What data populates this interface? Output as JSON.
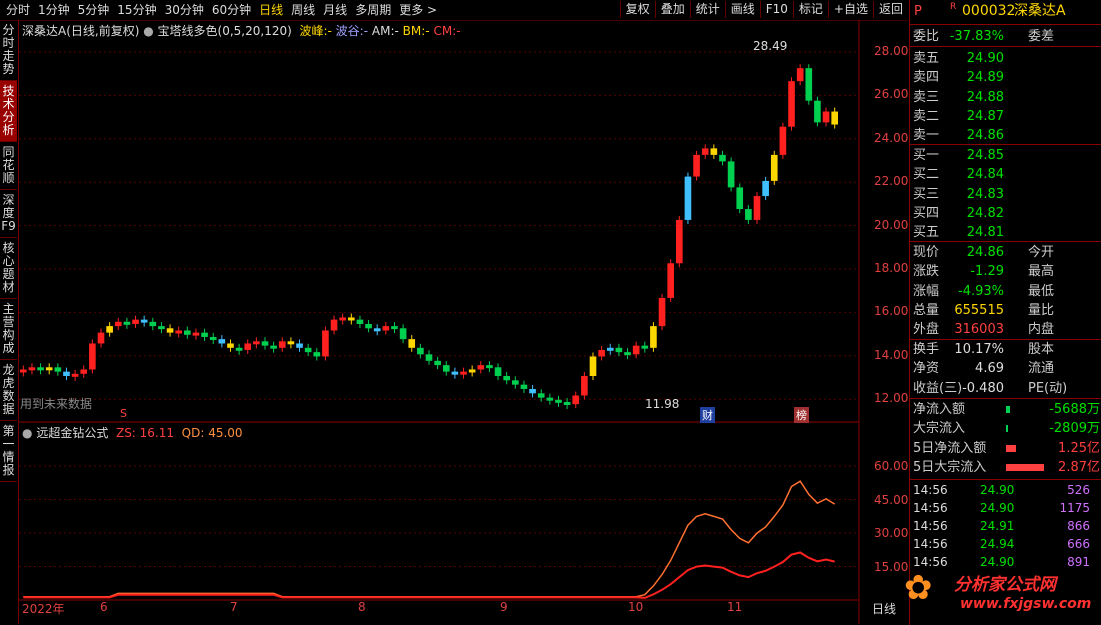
{
  "periods": [
    "分时",
    "1分钟",
    "5分钟",
    "15分钟",
    "30分钟",
    "60分钟",
    "日线",
    "周线",
    "月线",
    "多周期",
    "更多 >"
  ],
  "active_period": "日线",
  "toolbar": [
    "复权",
    "叠加",
    "统计",
    "画线",
    "F10",
    "标记",
    "+自选",
    "返回"
  ],
  "left_tabs": [
    "分时走势",
    "技术分析",
    "同花顺",
    "深度F9",
    "核心题材",
    "主营构成",
    "龙虎数据",
    "第一情报"
  ],
  "active_left_tab": "技术分析",
  "main_legend": {
    "title": "深桑达A(日线,前复权)",
    "indicator": "宝塔线多色(0,5,20,120)",
    "f1": "波峰:",
    "f1v": "-",
    "f2": "波谷:",
    "f2v": "-",
    "f3": "AM:",
    "f3v": "-",
    "f4": "BM:",
    "f4v": "-",
    "f5": "CM:",
    "f5v": "-"
  },
  "future_data": "用到未来数据",
  "high_label": "28.49",
  "low_label": "11.98",
  "event_cai": "财",
  "event_bang": "榜",
  "event_s": "S",
  "main_yticks": [
    "28.00",
    "26.00",
    "24.00",
    "22.00",
    "20.00",
    "18.00",
    "16.00",
    "14.00",
    "12.00"
  ],
  "sub_legend": {
    "name": "远超金钻公式",
    "zs": "ZS: 16.11",
    "qd": "QD: 45.00"
  },
  "sub_yticks": [
    "60.00",
    "45.00",
    "30.00",
    "15.00"
  ],
  "xaxis": [
    "2022年",
    "6",
    "7",
    "8",
    "9",
    "10",
    "11"
  ],
  "xaxis_right": "日线",
  "stock": {
    "flag": "P",
    "r": "R",
    "code": "000032",
    "name": "深桑达A"
  },
  "weibi": {
    "label": "委比",
    "value": "-37.83%",
    "label2": "委差"
  },
  "asks": [
    {
      "label": "卖五",
      "price": "24.90"
    },
    {
      "label": "卖四",
      "price": "24.89"
    },
    {
      "label": "卖三",
      "price": "24.88"
    },
    {
      "label": "卖二",
      "price": "24.87"
    },
    {
      "label": "卖一",
      "price": "24.86"
    }
  ],
  "bids": [
    {
      "label": "买一",
      "price": "24.85"
    },
    {
      "label": "买二",
      "price": "24.84"
    },
    {
      "label": "买三",
      "price": "24.83"
    },
    {
      "label": "买四",
      "price": "24.82"
    },
    {
      "label": "买五",
      "price": "24.81"
    }
  ],
  "quote": [
    {
      "l": "现价",
      "v": "24.86",
      "l2": "今开",
      "c": "g"
    },
    {
      "l": "涨跌",
      "v": "-1.29",
      "l2": "最高",
      "c": "g"
    },
    {
      "l": "涨幅",
      "v": "-4.93%",
      "l2": "最低",
      "c": "g"
    },
    {
      "l": "总量",
      "v": "655515",
      "l2": "量比",
      "c": "y"
    },
    {
      "l": "外盘",
      "v": "316003",
      "l2": "内盘",
      "c": "r"
    }
  ],
  "fund": [
    {
      "l": "换手",
      "v": "10.17%",
      "l2": "股本"
    },
    {
      "l": "净资",
      "v": "4.69",
      "l2": "流通"
    },
    {
      "l": "收益(三)",
      "v": "-0.480",
      "l2": "PE(动)"
    }
  ],
  "flow": [
    {
      "l": "净流入额",
      "v": "-5688万",
      "c": "g"
    },
    {
      "l": "大宗流入",
      "v": "-2809万",
      "c": "g"
    },
    {
      "l": "5日净流入额",
      "v": "1.25亿",
      "c": "r"
    },
    {
      "l": "5日大宗流入",
      "v": "2.87亿",
      "c": "r"
    }
  ],
  "ticks": [
    {
      "t": "14:56",
      "p": "24.90",
      "v": "526"
    },
    {
      "t": "14:56",
      "p": "24.90",
      "v": "1175"
    },
    {
      "t": "14:56",
      "p": "24.91",
      "v": "866"
    },
    {
      "t": "14:56",
      "p": "24.94",
      "v": "666"
    },
    {
      "t": "14:56",
      "p": "24.90",
      "v": "891"
    }
  ],
  "watermark": {
    "name": "分析家公式网",
    "url": "www.fxjgsw.com"
  },
  "chart_data": {
    "type": "bar",
    "title": "深桑达A(日线,前复权)",
    "ylim": [
      11.5,
      28.8
    ],
    "series": [
      {
        "values": [
          13.6,
          13.7,
          13.6,
          13.7,
          13.5,
          13.3,
          13.4,
          13.6,
          14.8,
          15.3,
          15.6,
          15.8,
          15.7,
          15.9,
          15.8,
          15.6,
          15.5,
          15.3,
          15.4,
          15.2,
          15.3,
          15.1,
          15.0,
          14.8,
          14.6,
          14.5,
          14.8,
          14.9,
          14.7,
          14.6,
          14.9,
          14.8,
          14.6,
          14.4,
          14.2,
          15.4,
          15.9,
          16.0,
          15.9,
          15.7,
          15.5,
          15.4,
          15.6,
          15.5,
          15.0,
          14.6,
          14.3,
          14.0,
          13.8,
          13.5,
          13.4,
          13.5,
          13.6,
          13.8,
          13.7,
          13.3,
          13.1,
          12.9,
          12.7,
          12.5,
          12.3,
          12.2,
          12.1,
          12.0,
          12.4,
          13.3,
          14.2,
          14.5,
          14.6,
          14.4,
          14.3,
          14.7,
          14.6,
          15.6,
          16.9,
          18.5,
          20.5,
          22.5,
          23.5,
          23.8,
          23.5,
          23.2,
          22.0,
          21.0,
          20.5,
          21.6,
          22.3,
          23.5,
          24.8,
          26.9,
          27.5,
          26.0,
          25.0,
          25.5,
          24.9
        ]
      }
    ]
  }
}
